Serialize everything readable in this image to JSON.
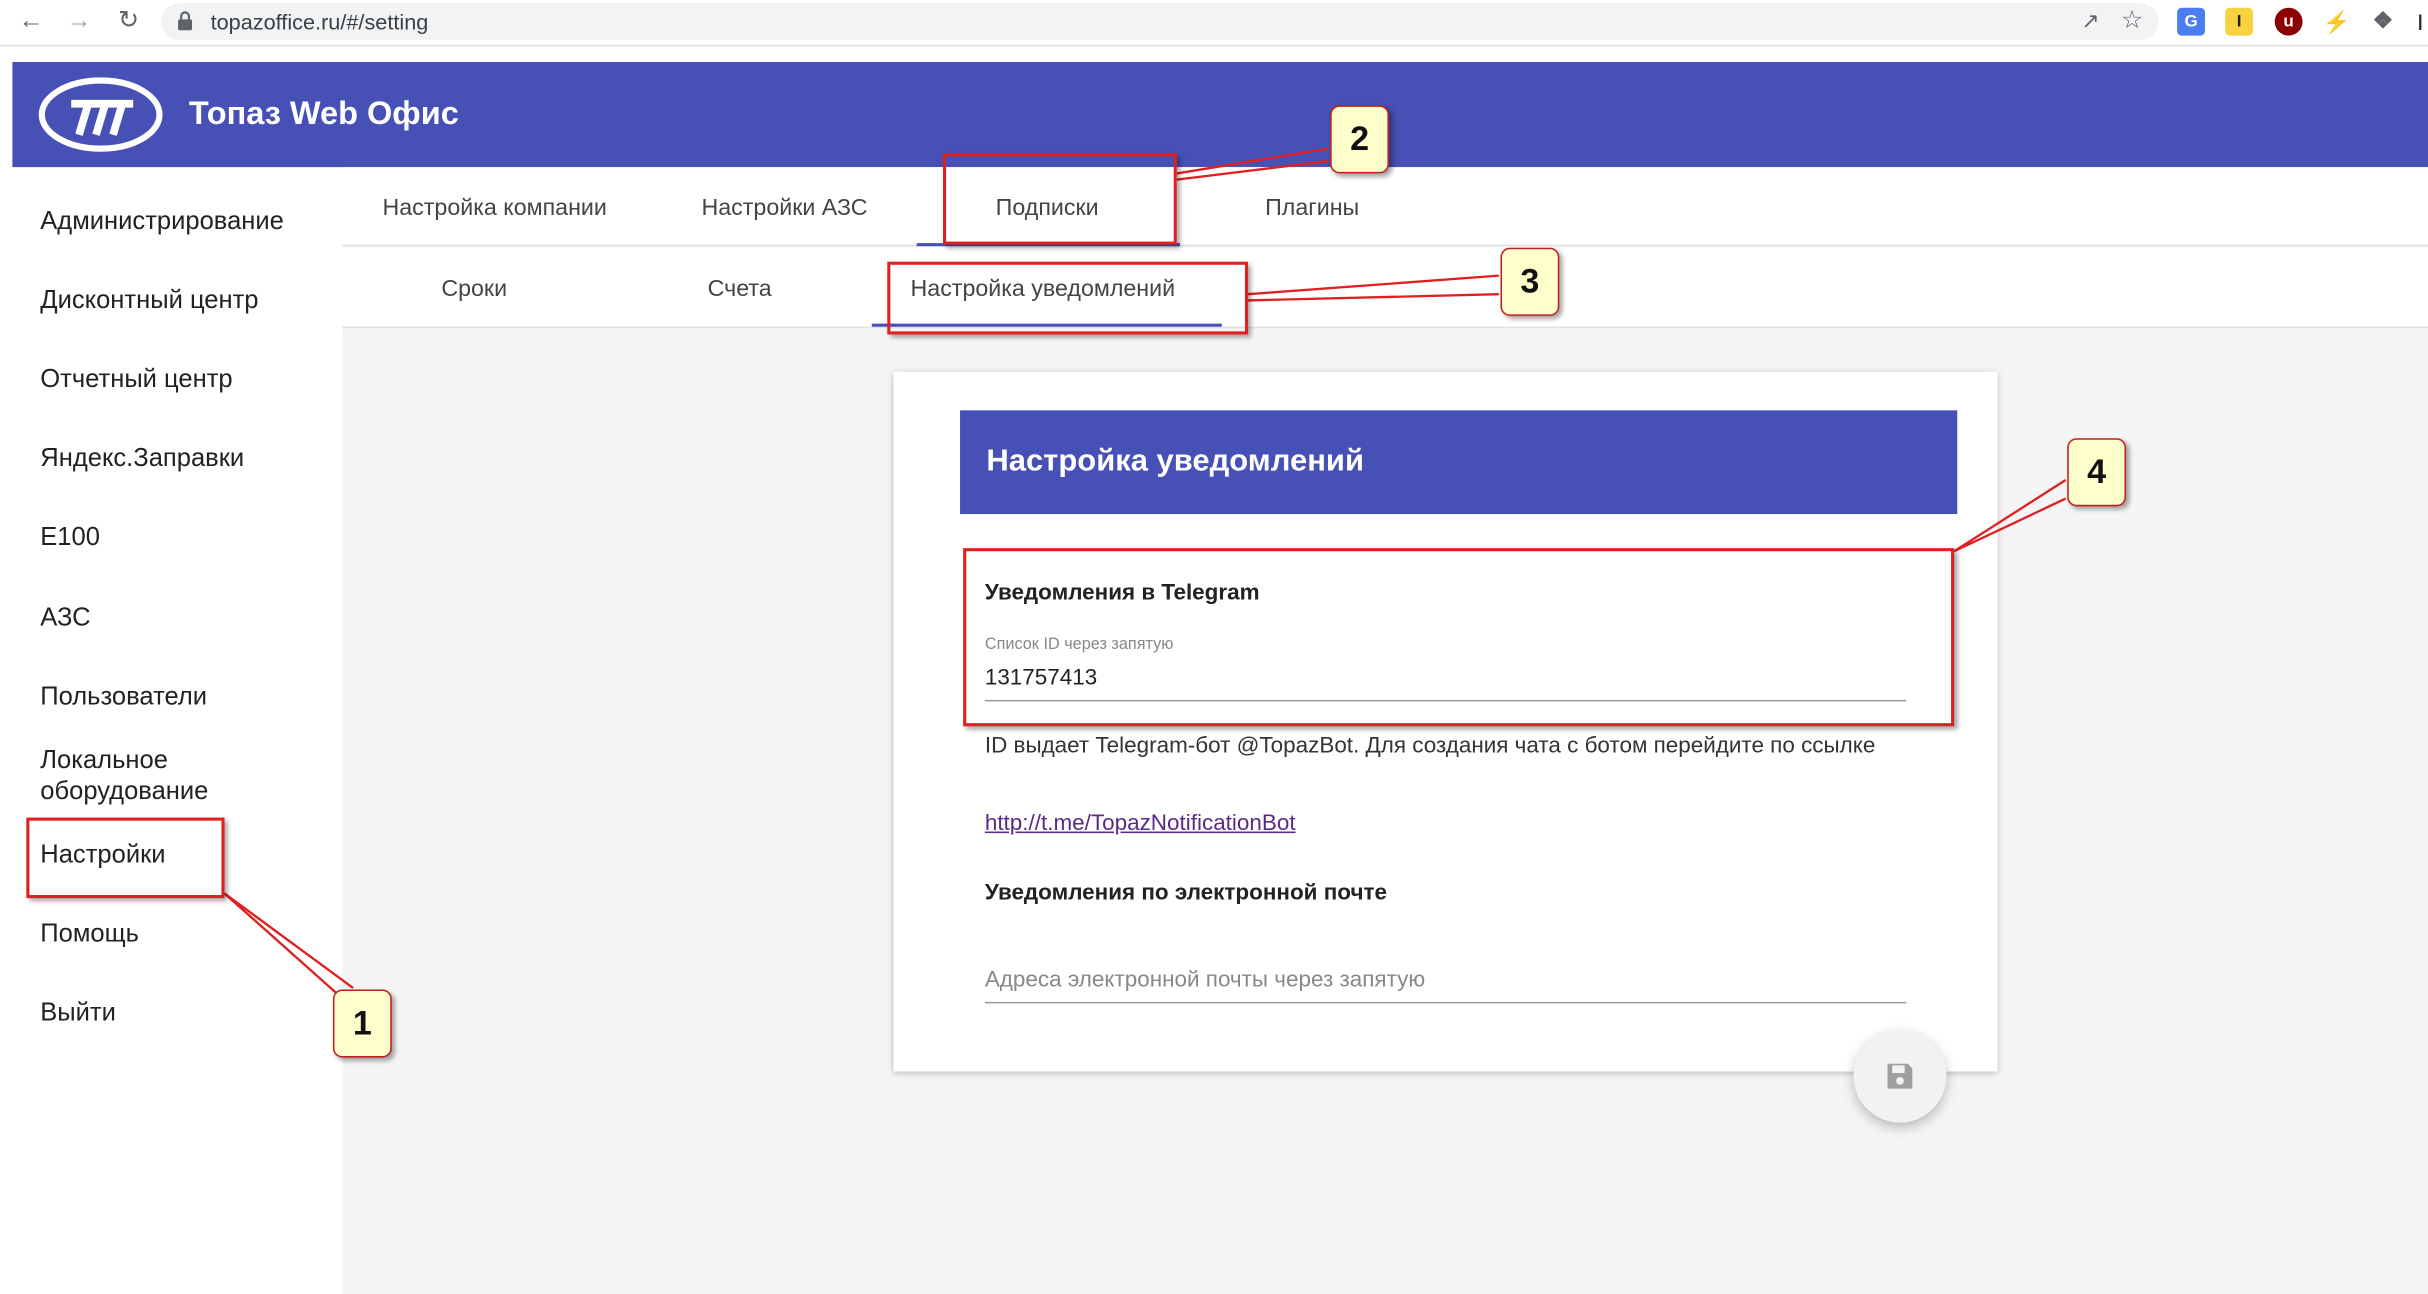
{
  "browser": {
    "url": "topazoffice.ru/#/setting"
  },
  "app": {
    "title": "Топаз Web Офис"
  },
  "sidebar": {
    "items": [
      {
        "label": "Администрирование"
      },
      {
        "label": "Дисконтный центр"
      },
      {
        "label": "Отчетный центр"
      },
      {
        "label": "Яндекс.Заправки"
      },
      {
        "label": "E100"
      },
      {
        "label": "АЗС"
      },
      {
        "label": "Пользователи"
      },
      {
        "label": "Локальное оборудование"
      },
      {
        "label": "Настройки"
      },
      {
        "label": "Помощь"
      },
      {
        "label": "Выйти"
      }
    ]
  },
  "tabs": [
    {
      "label": "Настройка компании"
    },
    {
      "label": "Настройки АЗС"
    },
    {
      "label": "Подписки",
      "active": true
    },
    {
      "label": "Плагины"
    }
  ],
  "subtabs": [
    {
      "label": "Сроки"
    },
    {
      "label": "Счета"
    },
    {
      "label": "Настройка уведомлений",
      "active": true
    }
  ],
  "card": {
    "title": "Настройка уведомлений",
    "telegram": {
      "section_title": "Уведомления в Telegram",
      "field_label": "Список ID через запятую",
      "field_value": "131757413",
      "help": "ID выдает Telegram-бот @TopazBot. Для создания чата с ботом перейдите по ссылке",
      "link": "http://t.me/TopazNotificationBot"
    },
    "email": {
      "section_title": "Уведомления по электронной почте",
      "placeholder": "Адреса электронной почты через запятую"
    }
  },
  "callouts": [
    "1",
    "2",
    "3",
    "4"
  ],
  "colors": {
    "accent": "#4650b5",
    "annotation": "#e02020",
    "callout_bg": "#ffffcc"
  }
}
